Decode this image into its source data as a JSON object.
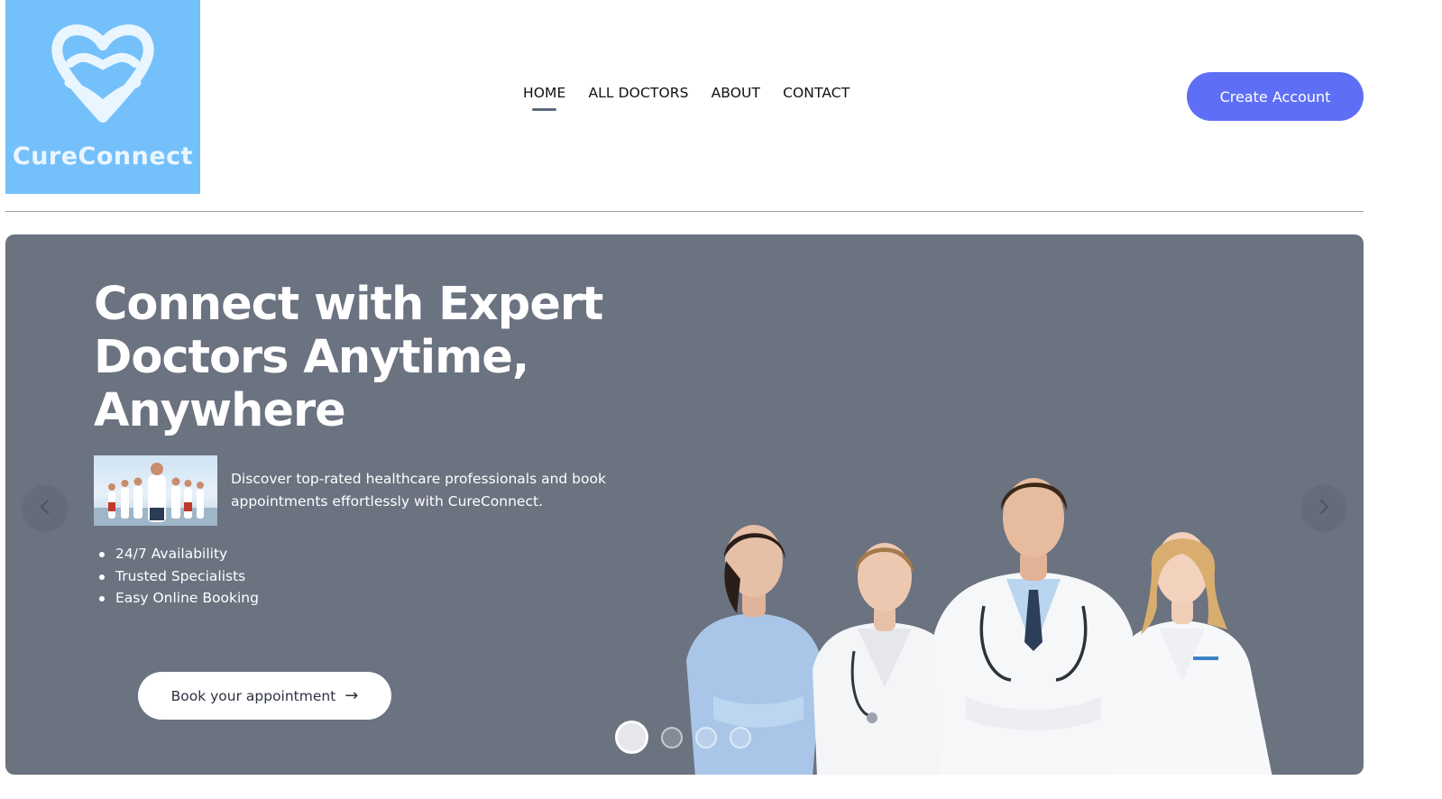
{
  "brand": {
    "name": "CureConnect",
    "logo_color": "#74c0fb"
  },
  "nav": {
    "items": [
      {
        "label": "HOME",
        "active": true
      },
      {
        "label": "ALL DOCTORS",
        "active": false
      },
      {
        "label": "ABOUT",
        "active": false
      },
      {
        "label": "CONTACT",
        "active": false
      }
    ]
  },
  "header": {
    "cta_label": "Create Account",
    "cta_color": "#5f6ff5"
  },
  "hero": {
    "background": "#6b7280",
    "title": "Connect with Expert Doctors Anytime, Anywhere",
    "description": "Discover top-rated healthcare professionals and book appointments effortlessly with CureConnect.",
    "bullets": [
      "24/7 Availability",
      "Trusted Specialists",
      "Easy Online Booking"
    ],
    "button_label": "Book your appointment",
    "button_icon": "arrow-right-icon",
    "prev_icon": "chevron-left-icon",
    "next_icon": "chevron-right-icon",
    "slides": {
      "count": 4,
      "active": 1
    }
  }
}
